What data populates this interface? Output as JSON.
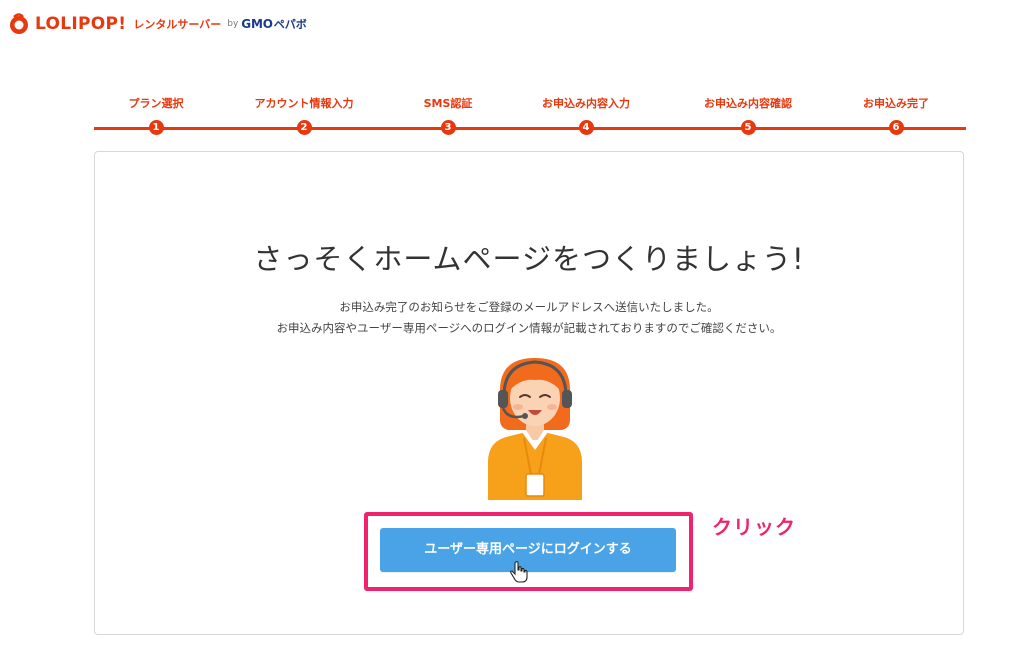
{
  "header": {
    "brand": "LOLIPOP!",
    "brand_sub": "レンタルサーバー",
    "by": "by",
    "gmo": "GMO",
    "pepabo": "ペパボ"
  },
  "steps": [
    {
      "label": "プラン選択",
      "num": "1"
    },
    {
      "label": "アカウント情報入力",
      "num": "2"
    },
    {
      "label": "SMS認証",
      "num": "3"
    },
    {
      "label": "お申込み内容入力",
      "num": "4"
    },
    {
      "label": "お申込み内容確認",
      "num": "5"
    },
    {
      "label": "お申込み完了",
      "num": "6"
    }
  ],
  "main": {
    "headline": "さっそくホームページをつくりましょう!",
    "lead_line1": "お申込み完了のお知らせをご登録のメールアドレスへ送信いたしました。",
    "lead_line2": "お申込み内容やユーザー専用ページへのログイン情報が記載されておりますのでご確認ください。",
    "login_button": "ユーザー専用ページにログインする"
  },
  "annotation": {
    "click_label": "クリック"
  },
  "colors": {
    "brand": "#e8380d",
    "button": "#4aa3e6",
    "highlight": "#f0246e"
  }
}
